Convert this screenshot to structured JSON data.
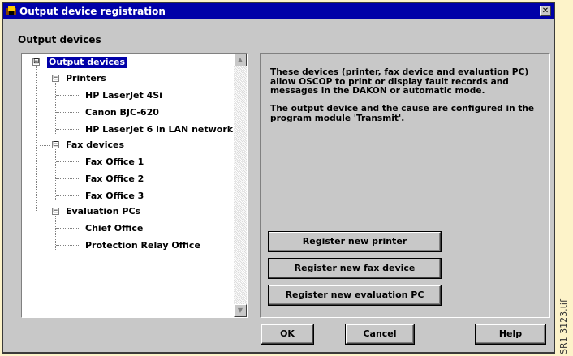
{
  "window": {
    "title": "Output device registration",
    "close_glyph": "✕",
    "title_icon": "app-icon"
  },
  "group_label": "Output devices",
  "tree": {
    "root": {
      "label": "Output devices",
      "selected": true,
      "expander": "⊟"
    },
    "groups": [
      {
        "label": "Printers",
        "expander": "⊟",
        "children": [
          "HP LaserJet 4Si",
          "Canon BJC-620",
          "HP LaserJet 6 in LAN network"
        ]
      },
      {
        "label": "Fax devices",
        "expander": "⊟",
        "children": [
          "Fax Office 1",
          "Fax Office 2",
          "Fax Office 3"
        ]
      },
      {
        "label": "Evaluation PCs",
        "expander": "⊟",
        "children": [
          "Chief Office",
          "Protection Relay Office"
        ]
      }
    ]
  },
  "scrollbar": {
    "up": "▲",
    "down": "▼"
  },
  "info": {
    "paragraph1": "These devices (printer, fax device and evaluation PC) allow OSCOP to print or display fault records and messages in the DAKON or automatic mode.",
    "paragraph2": "The output device and the cause are configured in the program module 'Transmit'."
  },
  "actions": {
    "register_printer": "Register new printer",
    "register_fax": "Register new fax device",
    "register_pc": "Register new evaluation PC"
  },
  "footer": {
    "ok": "OK",
    "cancel": "Cancel",
    "help": "Help"
  },
  "side_label": "SR1 3123.tif",
  "colors": {
    "titlebar": "#0000a8",
    "dialog": "#c8c8c8",
    "page": "#fdf3c9"
  }
}
